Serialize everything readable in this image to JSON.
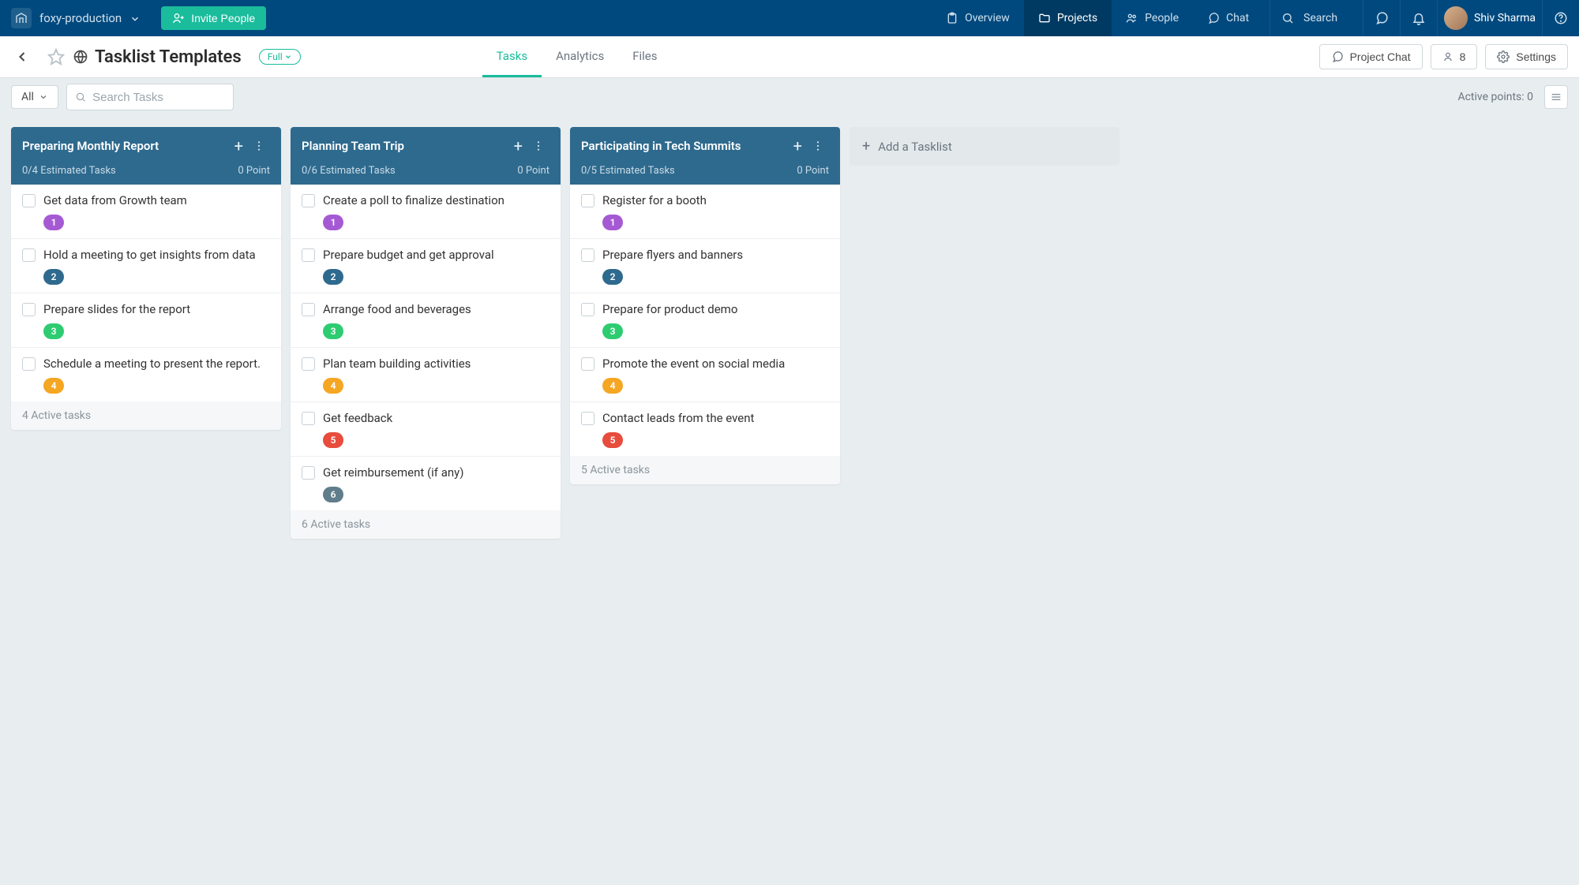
{
  "topbar": {
    "workspace_name": "foxy-production",
    "invite_label": "Invite People",
    "nav": [
      {
        "label": "Overview",
        "active": false
      },
      {
        "label": "Projects",
        "active": true
      },
      {
        "label": "People",
        "active": false
      },
      {
        "label": "Chat",
        "active": false
      }
    ],
    "search_label": "Search",
    "user_name": "Shiv Sharma"
  },
  "subbar": {
    "title": "Tasklist Templates",
    "pill": "Full",
    "tabs": [
      {
        "label": "Tasks",
        "active": true
      },
      {
        "label": "Analytics",
        "active": false
      },
      {
        "label": "Files",
        "active": false
      }
    ],
    "project_chat_label": "Project Chat",
    "people_count": "8",
    "settings_label": "Settings"
  },
  "filterbar": {
    "all_label": "All",
    "search_placeholder": "Search Tasks",
    "active_points_label": "Active points: 0"
  },
  "board": {
    "add_tasklist_label": "Add a Tasklist",
    "lists": [
      {
        "title": "Preparing Monthly Report",
        "estimated": "0/4 Estimated Tasks",
        "points": "0 Point",
        "tasks": [
          {
            "title": "Get data from Growth team",
            "badge": "1",
            "color": "purple"
          },
          {
            "title": "Hold a meeting to get insights from data",
            "badge": "2",
            "color": "blue"
          },
          {
            "title": "Prepare slides for the report",
            "badge": "3",
            "color": "green"
          },
          {
            "title": "Schedule a meeting to present the report.",
            "badge": "4",
            "color": "orange"
          }
        ],
        "footer": "4 Active tasks"
      },
      {
        "title": "Planning Team Trip",
        "estimated": "0/6 Estimated Tasks",
        "points": "0 Point",
        "tasks": [
          {
            "title": "Create a poll to finalize destination",
            "badge": "1",
            "color": "purple"
          },
          {
            "title": "Prepare budget and get approval",
            "badge": "2",
            "color": "blue"
          },
          {
            "title": "Arrange food and beverages",
            "badge": "3",
            "color": "green"
          },
          {
            "title": "Plan team building activities",
            "badge": "4",
            "color": "orange"
          },
          {
            "title": "Get feedback",
            "badge": "5",
            "color": "red"
          },
          {
            "title": "Get reimbursement (if any)",
            "badge": "6",
            "color": "slate"
          }
        ],
        "footer": "6 Active tasks"
      },
      {
        "title": "Participating in Tech Summits",
        "estimated": "0/5 Estimated Tasks",
        "points": "0 Point",
        "tasks": [
          {
            "title": "Register for a booth",
            "badge": "1",
            "color": "purple"
          },
          {
            "title": "Prepare flyers and banners",
            "badge": "2",
            "color": "blue"
          },
          {
            "title": "Prepare for product demo",
            "badge": "3",
            "color": "green"
          },
          {
            "title": "Promote the event on social media",
            "badge": "4",
            "color": "orange"
          },
          {
            "title": "Contact leads from the event",
            "badge": "5",
            "color": "red"
          }
        ],
        "footer": "5 Active tasks"
      }
    ]
  }
}
